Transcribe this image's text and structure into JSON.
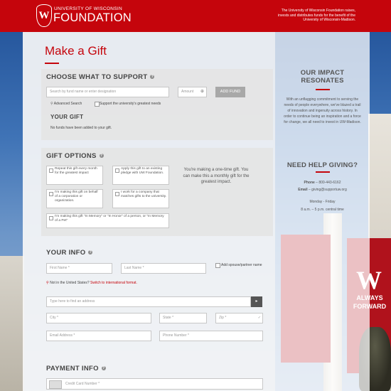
{
  "header": {
    "logo_top": "UNIVERSITY OF WISCONSIN",
    "logo_main": "FOUNDATION",
    "logo_crest": "W",
    "note": "The University of Wisconsin Foundation raises, invests and distributes funds for the benefit of the University of Wisconsin-Madison."
  },
  "page_title": "Make a Gift",
  "support": {
    "heading": "CHOOSE WHAT TO SUPPORT",
    "search_placeholder": "Search by fund name or enter designation",
    "amount_placeholder": "Amount",
    "add_fund_label": "ADD FUND",
    "advanced_search": "Advanced Search",
    "greatest_needs": "Support the university's greatest needs",
    "your_gift_heading": "YOUR GIFT",
    "no_funds_text": "No funds have been added to your gift."
  },
  "gift_options": {
    "heading": "GIFT OPTIONS",
    "options": [
      "Repeat this gift every month for the greatest impact",
      "Apply this gift to an existing pledge with UW Foundation.",
      "I'm making this gift on behalf of a corporation or organization.",
      "I work for a company that matches gifts to the university.",
      "I'm making this gift \"In Memory\" or \"In Honor\" of a person, or \"In Memory of a Pet\""
    ],
    "one_time_note": "You're making a one-time gift. You can make this a monthly gift for the greatest impact."
  },
  "your_info": {
    "heading": "YOUR INFO",
    "first_name": "First Name *",
    "last_name": "Last Name *",
    "add_spouse": "Add spouse/partner name",
    "not_us_text": "Not in the United States?",
    "intl_link": "Switch to international format.",
    "address_placeholder": "Type here to find an address",
    "city": "City *",
    "state": "State *",
    "zip": "Zip *",
    "email": "Email Address *",
    "phone": "Phone Number *"
  },
  "payment": {
    "heading": "PAYMENT INFO",
    "card_number": "Credit Card Number *"
  },
  "impact": {
    "heading_line1": "OUR IMPACT",
    "heading_line2": "RESONATES",
    "body": "With an unflagging commitment to serving the needs of people everywhere, we've blazed a trail of innovation and ingenuity across history. In order to continue being an inspiration and a force for change, we all need to invest in UW-Madison."
  },
  "help": {
    "heading": "NEED HELP GIVING?",
    "phone_label": "Phone",
    "phone": "800-443-6162",
    "email_label": "Email",
    "email": "giving@supportuw.org",
    "days": "Monday - Friday",
    "hours": "8 a.m. – 5 p.m. central time"
  },
  "background": {
    "banner_letter": "W",
    "banner_text": "ALWAYS FORWARD"
  },
  "colors": {
    "brand_red": "#c5050c",
    "button_gray": "#a8a8a8"
  }
}
